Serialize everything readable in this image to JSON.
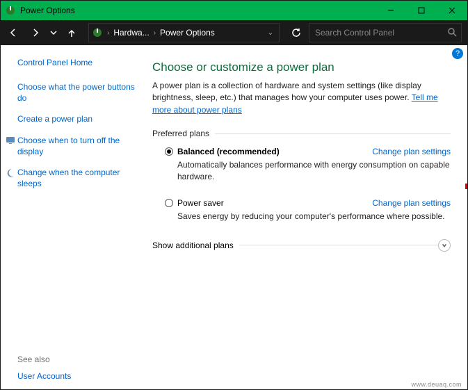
{
  "window": {
    "title": "Power Options"
  },
  "breadcrumb": {
    "seg1": "Hardwa...",
    "seg2": "Power Options"
  },
  "search": {
    "placeholder": "Search Control Panel"
  },
  "sidebar": {
    "home": "Control Panel Home",
    "link1": "Choose what the power buttons do",
    "link2": "Create a power plan",
    "link3": "Choose when to turn off the display",
    "link4": "Change when the computer sleeps",
    "see_also": "See also",
    "user_accounts": "User Accounts"
  },
  "main": {
    "heading": "Choose or customize a power plan",
    "desc": "A power plan is a collection of hardware and system settings (like display brightness, sleep, etc.) that manages how your computer uses power. ",
    "desc_link": "Tell me more about power plans",
    "preferred_label": "Preferred plans",
    "plans": [
      {
        "name": "Balanced (recommended)",
        "link": "Change plan settings",
        "desc": "Automatically balances performance with energy consumption on capable hardware."
      },
      {
        "name": "Power saver",
        "link": "Change plan settings",
        "desc": "Saves energy by reducing your computer's performance where possible."
      }
    ],
    "expander": "Show additional plans"
  },
  "help": "?",
  "watermark": "www.deuaq.com"
}
